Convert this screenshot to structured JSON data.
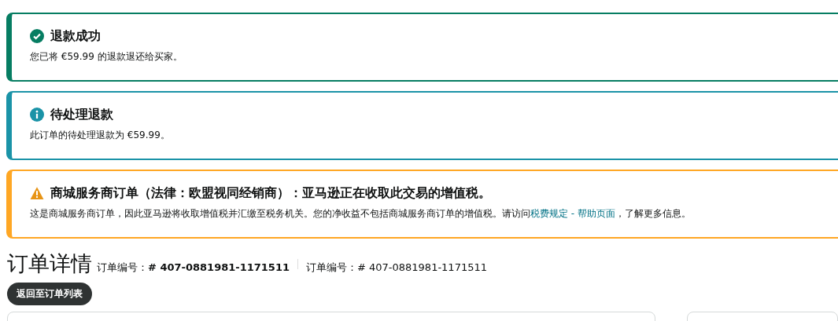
{
  "alerts": [
    {
      "kind": "success",
      "title": "退款成功",
      "text": "您已将 €59.99 的退款退还给买家。"
    },
    {
      "kind": "info",
      "title": "待处理退款",
      "text": "此订单的待处理退款为 €59.99。"
    },
    {
      "kind": "warning",
      "title": "商城服务商订单（法律：欧盟视同经销商）：亚马逊正在收取此交易的增值税。",
      "text": "这是商城服务商订单，因此亚马逊将收取增值税并汇缴至税务机关。您的净收益不包括商城服务商订单的增值税。请访问",
      "link": "税费规定 - 帮助页面",
      "text_after": "，了解更多信息。"
    }
  ],
  "header": {
    "title": "订单详情",
    "order_id_label": "订单编号：",
    "order_id": "# 407-0881981-1171511",
    "order_id_secondary": "订单编号：# 407-0881981-1171511"
  },
  "back_button": "返回至订单列表"
}
